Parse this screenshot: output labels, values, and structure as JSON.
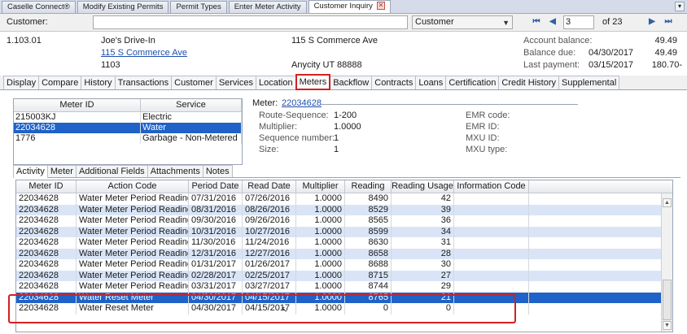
{
  "doc_tabs": [
    {
      "label": "Caselle Connect®",
      "active": false
    },
    {
      "label": "Modify Existing Permits",
      "active": false
    },
    {
      "label": "Permit Types",
      "active": false
    },
    {
      "label": "Enter Meter Activity",
      "active": false
    },
    {
      "label": "Customer Inquiry",
      "active": true
    }
  ],
  "customer_bar": {
    "label": "Customer:",
    "input_value": "",
    "search_by": "Customer",
    "page": "3",
    "page_of": "of 23"
  },
  "header": {
    "account_number": "1.103.01",
    "name": "Joe's Drive-In",
    "service_address_link": "115 S Commerce Ave",
    "account_code": "1103",
    "mailing_address": "115 S Commerce Ave",
    "city_state_zip": "Anycity  UT  88888",
    "account_balance_label": "Account balance:",
    "account_balance": "49.49",
    "balance_due_label": "Balance due:",
    "balance_due_date": "04/30/2017",
    "balance_due": "49.49",
    "last_payment_label": "Last payment:",
    "last_payment_date": "03/15/2017",
    "last_payment": "180.70-"
  },
  "main_tabs": [
    "Display",
    "Compare",
    "History",
    "Transactions",
    "Customer",
    "Services",
    "Location",
    "Meters",
    "Backflow",
    "Contracts",
    "Loans",
    "Certification",
    "Credit History",
    "Supplemental"
  ],
  "meter_list": {
    "headers": [
      "Meter ID",
      "Service"
    ],
    "rows": [
      {
        "id": "215003KJ",
        "service": "Electric",
        "selected": false
      },
      {
        "id": "22034628",
        "service": "Water",
        "selected": true
      },
      {
        "id": "1776",
        "service": "Garbage - Non-Metered",
        "selected": false
      }
    ]
  },
  "meter_detail": {
    "meter_label": "Meter:",
    "meter_link": "22034628",
    "route_label": "Route-Sequence:",
    "route_value": "1-200",
    "multiplier_label": "Multiplier:",
    "multiplier_value": "1.0000",
    "sequence_label": "Sequence number:",
    "sequence_value": "1",
    "size_label": "Size:",
    "size_value": "1",
    "emr_code_label": "EMR code:",
    "emr_id_label": "EMR ID:",
    "mxu_id_label": "MXU ID:",
    "mxu_type_label": "MXU type:"
  },
  "sub_tabs": [
    "Activity",
    "Meter",
    "Additional Fields",
    "Attachments",
    "Notes"
  ],
  "activity": {
    "headers": [
      "Meter ID",
      "Action Code",
      "Period Date",
      "Read Date",
      "Multiplier",
      "Reading",
      "Reading Usage",
      "Information Code"
    ],
    "rows": [
      [
        "22034628",
        "Water Meter Period Reading",
        "07/31/2016",
        "07/26/2016",
        "1.0000",
        "8490",
        "42",
        ""
      ],
      [
        "22034628",
        "Water Meter Period Reading",
        "08/31/2016",
        "08/26/2016",
        "1.0000",
        "8529",
        "39",
        ""
      ],
      [
        "22034628",
        "Water Meter Period Reading",
        "09/30/2016",
        "09/26/2016",
        "1.0000",
        "8565",
        "36",
        ""
      ],
      [
        "22034628",
        "Water Meter Period Reading",
        "10/31/2016",
        "10/27/2016",
        "1.0000",
        "8599",
        "34",
        ""
      ],
      [
        "22034628",
        "Water Meter Period Reading",
        "11/30/2016",
        "11/24/2016",
        "1.0000",
        "8630",
        "31",
        ""
      ],
      [
        "22034628",
        "Water Meter Period Reading",
        "12/31/2016",
        "12/27/2016",
        "1.0000",
        "8658",
        "28",
        ""
      ],
      [
        "22034628",
        "Water Meter Period Reading",
        "01/31/2017",
        "01/26/2017",
        "1.0000",
        "8688",
        "30",
        ""
      ],
      [
        "22034628",
        "Water Meter Period Reading",
        "02/28/2017",
        "02/25/2017",
        "1.0000",
        "8715",
        "27",
        ""
      ],
      [
        "22034628",
        "Water Meter Period Reading",
        "03/31/2017",
        "03/27/2017",
        "1.0000",
        "8744",
        "29",
        ""
      ],
      [
        "22034628",
        "Water Reset Meter",
        "04/30/2017",
        "04/15/2017",
        "1.0000",
        "8765",
        "21",
        ""
      ],
      [
        "22034628",
        "Water Reset Meter",
        "04/30/2017",
        "04/15/2017",
        "1.0000",
        "0",
        "0",
        ""
      ]
    ],
    "selected_row": 9
  }
}
